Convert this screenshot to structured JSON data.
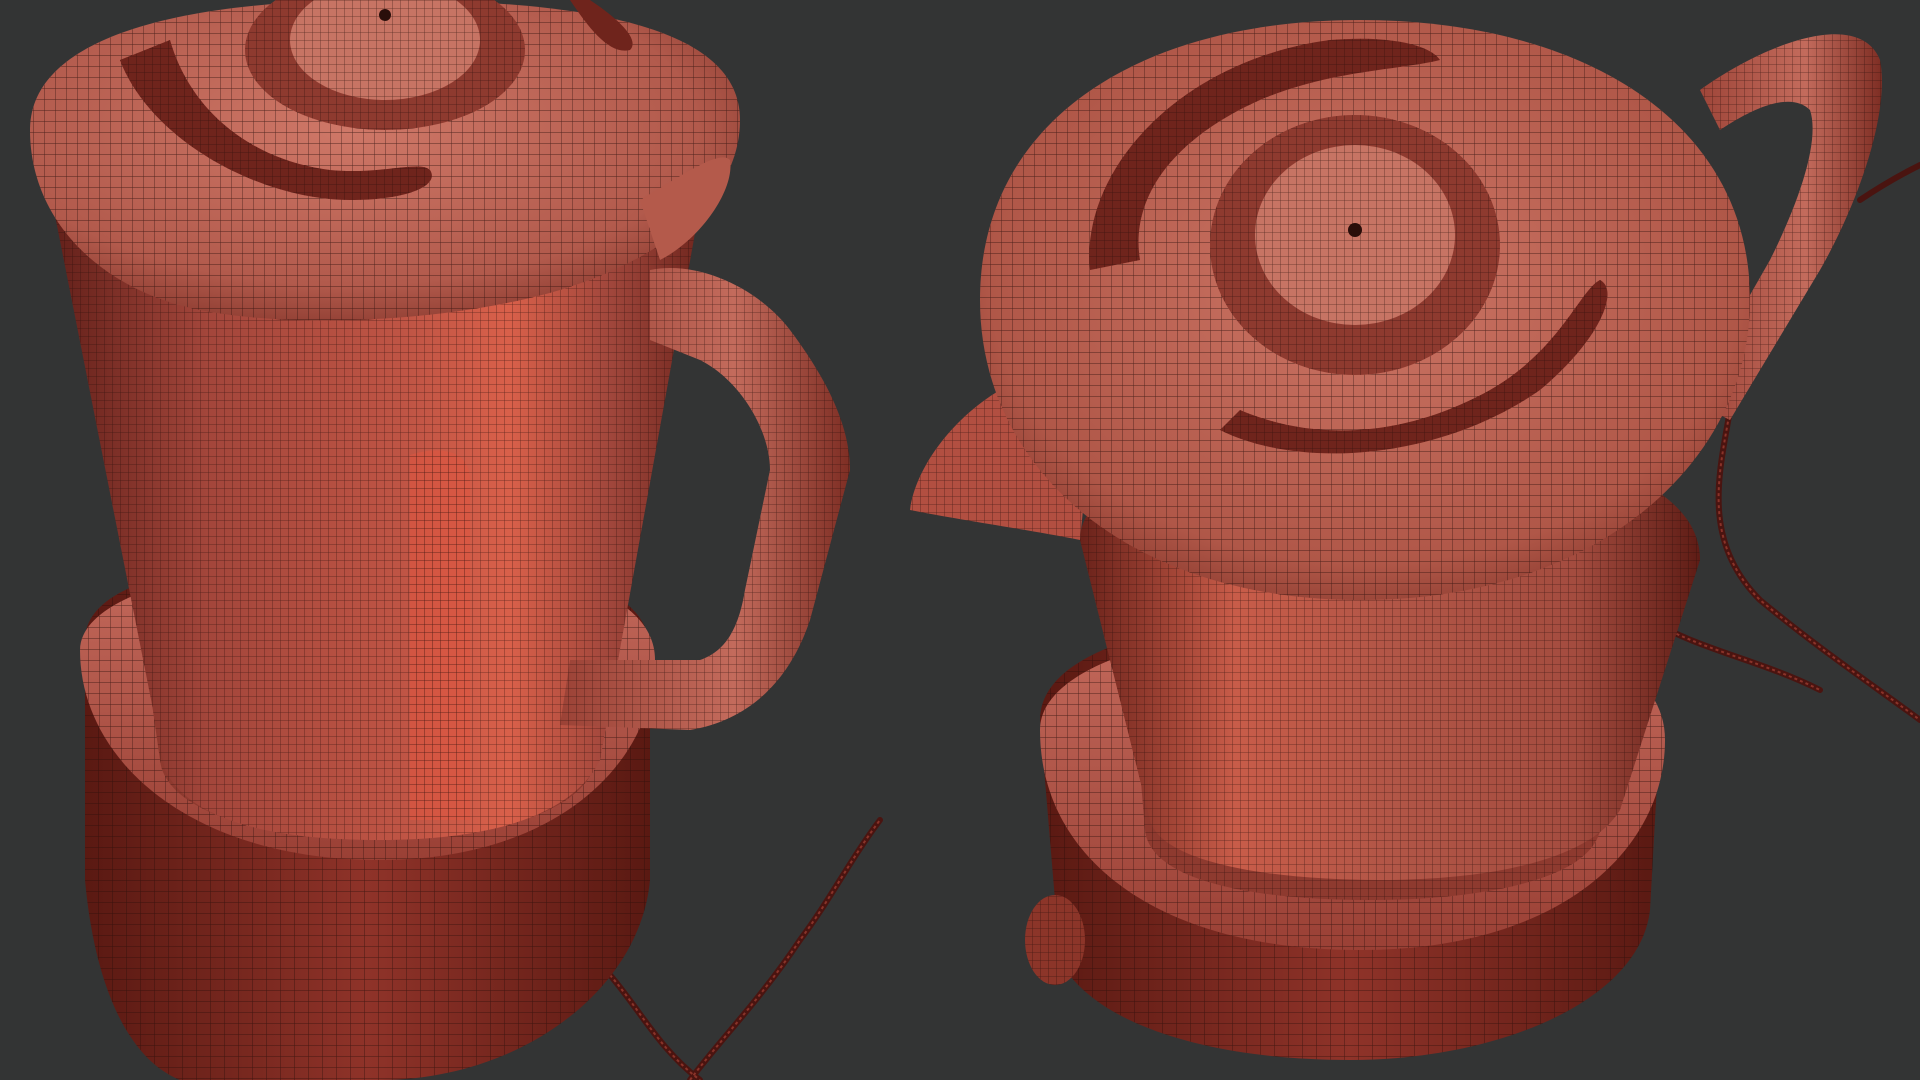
{
  "scene": {
    "background": "#333434",
    "subject": "blender-wireframe-render",
    "views": [
      {
        "name": "blender-front-view"
      },
      {
        "name": "blender-top-view"
      }
    ],
    "colors": {
      "shade_light": "#cf7566",
      "shade_mid": "#a84a40",
      "shade_dark": "#5a1a14",
      "highlight": "#e0553f",
      "wire": "#2a0e0a"
    }
  }
}
